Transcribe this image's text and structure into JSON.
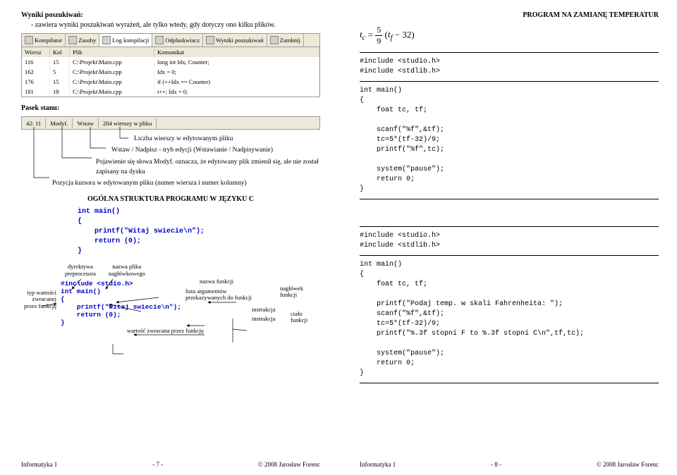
{
  "left": {
    "h_wyniki": "Wyniki poszukiwań:",
    "wyniki_desc": "- zawiera wyniki poszukiwań wyrażeń, ale tylko wtedy, gdy dotyczy ono kilku plików.",
    "tabbar": [
      "Kompilator",
      "Zasoby",
      "Log kompilacji",
      "Odpluskwiacz",
      "Wyniki poszukiwań",
      "Zamknij"
    ],
    "grid_headers": [
      "Wiersz",
      "Kol",
      "Plik",
      "Komunikat"
    ],
    "grid_rows": [
      [
        "116",
        "15",
        "C:\\Projekt\\Main.cpp",
        "long int  Idx, Counter;"
      ],
      [
        "162",
        "5",
        "C:\\Projekt\\Main.cpp",
        "Idx = 0;"
      ],
      [
        "176",
        "15",
        "C:\\Projekt\\Main.cpp",
        "if (++Idx == Counter)"
      ],
      [
        "181",
        "18",
        "C:\\Projekt\\Main.cpp",
        "i++; Idx = 0;"
      ]
    ],
    "h_pasek": "Pasek stanu:",
    "status": [
      "42: 11",
      "Modyf.",
      "Wstaw",
      "204 wierszy w pliku"
    ],
    "callouts": [
      "Liczba wierszy w edytowanym pliku",
      "Wstaw / Nadpisz - tryb edycji (Wstawianie / Nadpisywanie)",
      "Pojawienie się słowa Modyf. oznacza, że edytowany plik zmienił się, ale nie został zapisany na dysku",
      "Pozycja kursora w edytowanym pliku (numer wiersza i numer kolumny)"
    ],
    "h_struct": "OGÓLNA STRUKTURA PROGRAMU W JĘZYKU C",
    "code1_l1": "int main()",
    "code1_l2": "{",
    "code1_l3": "    printf(\"Witaj swiecie\\n\");",
    "code1_l4": "    return (0);",
    "code1_l5": "}",
    "lbl_dyr1": "dyrektywa",
    "lbl_dyr2": "preprocesora",
    "lbl_nazpl1": "nazwa pliku",
    "lbl_nazpl2": "nagłówkowego",
    "lbl_typ1": "typ wartości",
    "lbl_typ2": "zwracanej",
    "lbl_typ3": "przez funkcję",
    "lbl_nazfun": "nazwa funkcji",
    "lbl_arg1": "lista argumentów",
    "lbl_arg2": "przekazywanych do funkcji",
    "lbl_nagfun": "nagłówek funkcji",
    "lbl_cialo": "ciało funkcji",
    "lbl_instr": "instrukcja",
    "lbl_wart": "wartość zwracana przez funkcję",
    "fc_inc": "#include <stdio.h>",
    "fc_main": "int main()",
    "fc_ob": "{",
    "fc_printf": "    printf(\"Witaj swiecie\\n\");",
    "fc_ret": "    return (0);",
    "fc_cb": "}",
    "footer_l": "Informatyka 1",
    "footer_c": "- 7 -",
    "footer_r": "© 2008 Jarosław Forenc"
  },
  "right": {
    "title": "PROGRAM NA ZAMIANĘ TEMPERATUR",
    "inc1": "#include <studio.h>",
    "inc2": "#include <stdlib.h>",
    "c1": "int main()\n{\n    foat tc, tf;\n\n    scanf(\"%f\",&tf);\n    tc=5*(tf-32)/9;\n    printf(\"%f\",tc);\n\n    system(\"pause\");\n    return 0;\n}",
    "c2": "int main()\n{\n    foat tc, tf;\n\n    printf(\"Podaj temp. w skali Fahrenheita: \");\n    scanf(\"%f\",&tf);\n    tc=5*(tf-32)/9;\n    printf(\"%.3f stopni F to %.3f stopni C\\n\",tf,tc);\n\n    system(\"pause\");\n    return 0;\n}",
    "footer_l": "Informatyka 1",
    "footer_c": "- 8 -",
    "footer_r": "© 2008 Jarosław Forenc"
  }
}
